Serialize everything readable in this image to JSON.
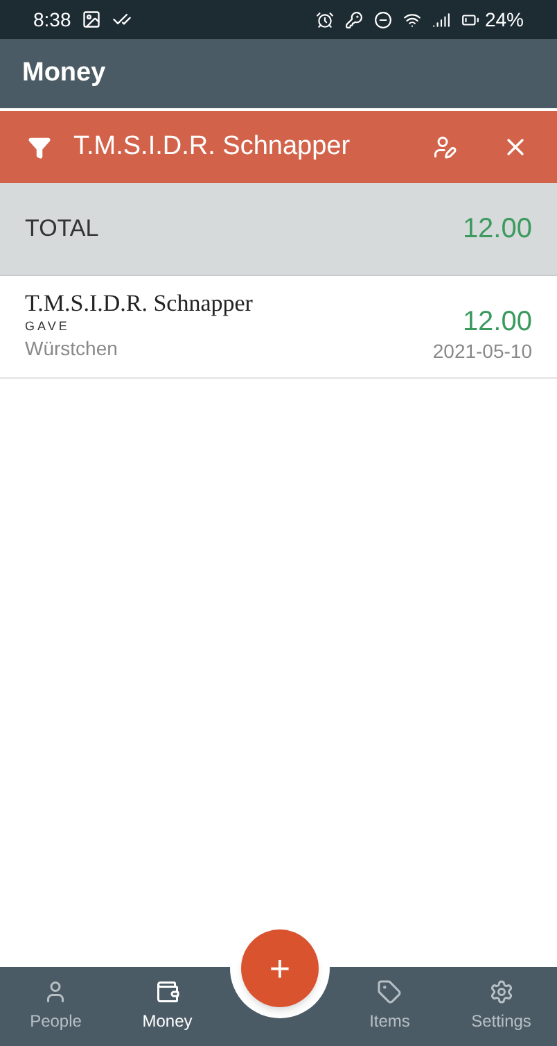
{
  "status_bar": {
    "time": "8:38",
    "battery": "24%"
  },
  "header": {
    "title": "Money"
  },
  "filter": {
    "label": "T.M.S.I.D.R. Schnapper"
  },
  "total": {
    "label": "TOTAL",
    "amount": "12.00"
  },
  "entries": [
    {
      "name": "T.M.S.I.D.R. Schnapper",
      "direction": "GAVE",
      "item": "Würstchen",
      "amount": "12.00",
      "date": "2021-05-10"
    }
  ],
  "nav": [
    {
      "kind": "person",
      "label": "People",
      "selected": false
    },
    {
      "kind": "wallet",
      "label": "Money",
      "selected": true
    },
    {
      "kind": "fab",
      "label": "+"
    },
    {
      "kind": "tag",
      "label": "Items",
      "selected": false
    },
    {
      "kind": "gear",
      "label": "Settings",
      "selected": false
    }
  ]
}
